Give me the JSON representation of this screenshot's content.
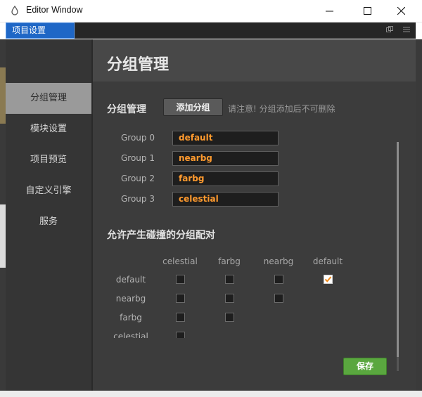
{
  "window": {
    "title": "Editor Window",
    "controls": {
      "minimize_icon": "minimize-icon",
      "maximize_icon": "maximize-icon",
      "close_icon": "close-icon"
    }
  },
  "tab": {
    "label": "项目设置",
    "accent": "#1f67c6"
  },
  "sidebar": {
    "items": [
      {
        "label": "分组管理",
        "active": true
      },
      {
        "label": "模块设置",
        "active": false
      },
      {
        "label": "项目预览",
        "active": false
      },
      {
        "label": "自定义引擎",
        "active": false
      },
      {
        "label": "服务",
        "active": false
      }
    ]
  },
  "header": {
    "title": "分组管理"
  },
  "groups_section": {
    "title": "分组管理",
    "add_button": "添加分组",
    "notice": "请注意! 分组添加后不可删除",
    "groups": [
      {
        "label": "Group 0",
        "value": "default"
      },
      {
        "label": "Group 1",
        "value": "nearbg"
      },
      {
        "label": "Group 2",
        "value": "farbg"
      },
      {
        "label": "Group 3",
        "value": "celestial"
      }
    ],
    "value_color": "#ff9a2e"
  },
  "collision_section": {
    "title": "允许产生碰撞的分组配对",
    "columns": [
      "celestial",
      "farbg",
      "nearbg",
      "default"
    ],
    "rows": [
      {
        "label": "default",
        "checks": [
          false,
          false,
          false,
          true
        ]
      },
      {
        "label": "nearbg",
        "checks": [
          false,
          false,
          false
        ]
      },
      {
        "label": "farbg",
        "checks": [
          false,
          false
        ]
      },
      {
        "label": "celestial",
        "checks": [
          false
        ]
      }
    ]
  },
  "save_button": {
    "label": "保存",
    "color": "#5aa73f"
  }
}
